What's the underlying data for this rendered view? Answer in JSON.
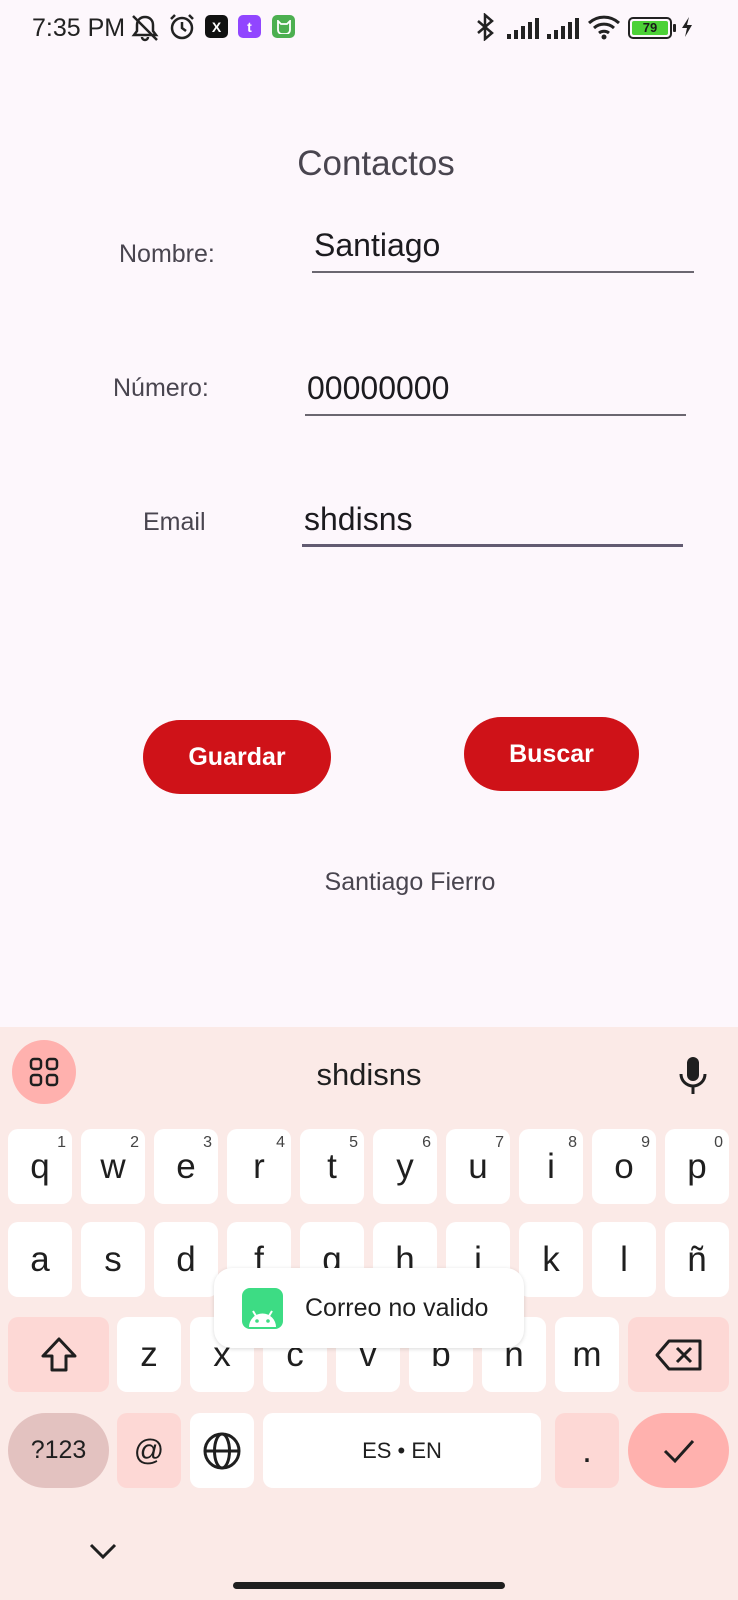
{
  "status_bar": {
    "time": "7:35 PM",
    "battery_level": "79",
    "icons": [
      "notifications-off-icon",
      "alarm-icon",
      "x-app-icon",
      "twitch-app-icon",
      "cat-app-icon",
      "bluetooth-icon",
      "signal-icon",
      "signal-icon",
      "wifi-icon",
      "battery-icon",
      "charging-icon"
    ],
    "app_badges": {
      "x": "X",
      "twitch": "t"
    },
    "colors": {
      "x": "#111111",
      "twitch": "#9146ff",
      "cat": "#4caf50",
      "battery": "#4cd137"
    }
  },
  "app": {
    "title": "Contactos",
    "fields": {
      "name": {
        "label": "Nombre:",
        "value": "Santiago"
      },
      "number": {
        "label": "Número:",
        "value": "00000000"
      },
      "email": {
        "label": "Email",
        "value": "shdisns"
      }
    },
    "buttons": {
      "save": "Guardar",
      "search": "Buscar"
    },
    "result": "Santiago Fierro",
    "colors": {
      "accent": "#cf1218",
      "background": "#fdf7fc"
    }
  },
  "keyboard": {
    "suggestion": "shdisns",
    "row1": [
      {
        "key": "q",
        "hint": "1"
      },
      {
        "key": "w",
        "hint": "2"
      },
      {
        "key": "e",
        "hint": "3"
      },
      {
        "key": "r",
        "hint": "4"
      },
      {
        "key": "t",
        "hint": "5"
      },
      {
        "key": "y",
        "hint": "6"
      },
      {
        "key": "u",
        "hint": "7"
      },
      {
        "key": "i",
        "hint": "8"
      },
      {
        "key": "o",
        "hint": "9"
      },
      {
        "key": "p",
        "hint": "0"
      }
    ],
    "row2": [
      "a",
      "s",
      "d",
      "f",
      "g",
      "h",
      "j",
      "k",
      "l",
      "ñ"
    ],
    "row3": [
      "z",
      "x",
      "c",
      "v",
      "b",
      "n",
      "m"
    ],
    "row4": {
      "symbols": "?123",
      "at": "@",
      "space": "ES • EN",
      "period": "."
    },
    "colors": {
      "background": "#fbeae7",
      "enter": "#ffb1ae"
    }
  },
  "toast": {
    "message": "Correo no valido",
    "icon": "android-icon"
  }
}
